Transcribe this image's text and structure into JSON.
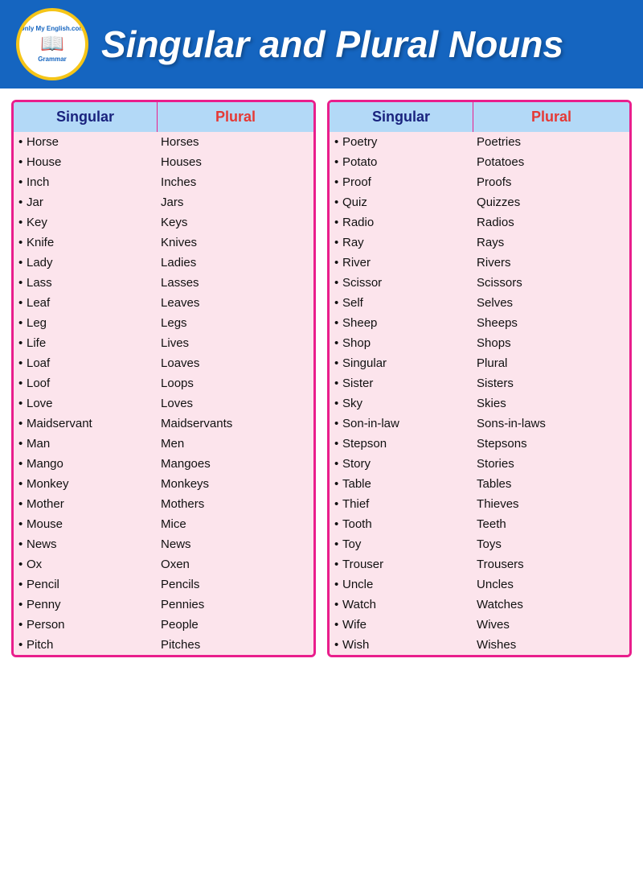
{
  "header": {
    "logo_top": "Only My English.com",
    "logo_bottom": "Grammar",
    "title": "Singular and Plural Nouns"
  },
  "left_column": {
    "header_singular": "Singular",
    "header_plural": "Plural",
    "rows": [
      {
        "singular": "Horse",
        "plural": "Horses"
      },
      {
        "singular": "House",
        "plural": "Houses"
      },
      {
        "singular": "Inch",
        "plural": "Inches"
      },
      {
        "singular": "Jar",
        "plural": "Jars"
      },
      {
        "singular": "Key",
        "plural": "Keys"
      },
      {
        "singular": "Knife",
        "plural": "Knives"
      },
      {
        "singular": "Lady",
        "plural": "Ladies"
      },
      {
        "singular": "Lass",
        "plural": "Lasses"
      },
      {
        "singular": "Leaf",
        "plural": "Leaves"
      },
      {
        "singular": "Leg",
        "plural": "Legs"
      },
      {
        "singular": "Life",
        "plural": "Lives"
      },
      {
        "singular": "Loaf",
        "plural": "Loaves"
      },
      {
        "singular": "Loof",
        "plural": "Loops"
      },
      {
        "singular": "Love",
        "plural": "Loves"
      },
      {
        "singular": "Maidservant",
        "plural": "Maidservants"
      },
      {
        "singular": "Man",
        "plural": "Men"
      },
      {
        "singular": "Mango",
        "plural": "Mangoes"
      },
      {
        "singular": "Monkey",
        "plural": "Monkeys"
      },
      {
        "singular": "Mother",
        "plural": "Mothers"
      },
      {
        "singular": "Mouse",
        "plural": "Mice"
      },
      {
        "singular": "News",
        "plural": "News"
      },
      {
        "singular": "Ox",
        "plural": "Oxen"
      },
      {
        "singular": "Pencil",
        "plural": "Pencils"
      },
      {
        "singular": "Penny",
        "plural": "Pennies"
      },
      {
        "singular": "Person",
        "plural": "People"
      },
      {
        "singular": "Pitch",
        "plural": "Pitches"
      }
    ]
  },
  "right_column": {
    "header_singular": "Singular",
    "header_plural": "Plural",
    "rows": [
      {
        "singular": "Poetry",
        "plural": "Poetries"
      },
      {
        "singular": "Potato",
        "plural": "Potatoes"
      },
      {
        "singular": "Proof",
        "plural": "Proofs"
      },
      {
        "singular": "Quiz",
        "plural": "Quizzes"
      },
      {
        "singular": "Radio",
        "plural": "Radios"
      },
      {
        "singular": "Ray",
        "plural": "Rays"
      },
      {
        "singular": "River",
        "plural": "Rivers"
      },
      {
        "singular": "Scissor",
        "plural": "Scissors"
      },
      {
        "singular": "Self",
        "plural": "Selves"
      },
      {
        "singular": "Sheep",
        "plural": "Sheeps"
      },
      {
        "singular": "Shop",
        "plural": "Shops"
      },
      {
        "singular": "Singular",
        "plural": "Plural"
      },
      {
        "singular": "Sister",
        "plural": "Sisters"
      },
      {
        "singular": "Sky",
        "plural": "Skies"
      },
      {
        "singular": "Son-in-law",
        "plural": "Sons-in-laws"
      },
      {
        "singular": "Stepson",
        "plural": "Stepsons"
      },
      {
        "singular": "Story",
        "plural": "Stories"
      },
      {
        "singular": "Table",
        "plural": "Tables"
      },
      {
        "singular": "Thief",
        "plural": "Thieves"
      },
      {
        "singular": "Tooth",
        "plural": "Teeth"
      },
      {
        "singular": "Toy",
        "plural": "Toys"
      },
      {
        "singular": "Trouser",
        "plural": "Trousers"
      },
      {
        "singular": "Uncle",
        "plural": "Uncles"
      },
      {
        "singular": "Watch",
        "plural": "Watches"
      },
      {
        "singular": "Wife",
        "plural": "Wives"
      },
      {
        "singular": "Wish",
        "plural": "Wishes"
      }
    ]
  }
}
